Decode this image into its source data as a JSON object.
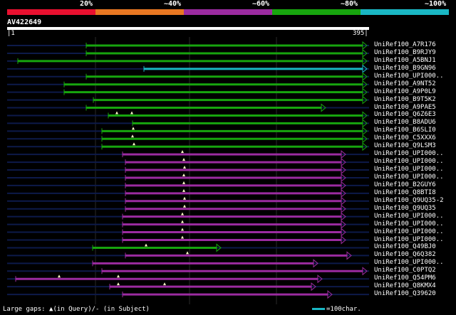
{
  "scale": {
    "ticks": [
      "20%",
      "~40%",
      "~60%",
      "~80%",
      "~100%"
    ],
    "colors": [
      "#e8102f",
      "#e87722",
      "#9b2ba0",
      "#17a50e",
      "#1ab7c4"
    ]
  },
  "query": {
    "name": "AV422649",
    "start": "|1",
    "end": "395|"
  },
  "hits": [
    {
      "name": "UniRef100_A7R176",
      "color": "green",
      "start": 121,
      "end": 515,
      "gaps": []
    },
    {
      "name": "UniRef100_B9RJY9",
      "color": "green",
      "start": 121,
      "end": 515,
      "gaps": []
    },
    {
      "name": "UniRef100_A5BNJ1",
      "color": "green",
      "start": 25,
      "end": 515,
      "gaps": []
    },
    {
      "name": "UniRef100_B9GN96",
      "color": "cyan",
      "start": 202,
      "end": 515,
      "gaps": []
    },
    {
      "name": "UniRef100_UPI000..",
      "color": "green",
      "start": 121,
      "end": 515,
      "gaps": []
    },
    {
      "name": "UniRef100_A9NT52",
      "color": "green",
      "start": 90,
      "end": 515,
      "gaps": []
    },
    {
      "name": "UniRef100_A9P0L9",
      "color": "green",
      "start": 90,
      "end": 515,
      "gaps": []
    },
    {
      "name": "UniRef100_B9T5K2",
      "color": "green",
      "start": 131,
      "end": 515,
      "gaps": []
    },
    {
      "name": "UniRef100_A9PAE5",
      "color": "green",
      "start": 121,
      "end": 457,
      "gaps": []
    },
    {
      "name": "UniRef100_Q6Z6E3",
      "color": "green",
      "start": 152,
      "end": 515,
      "gaps": [
        164,
        185
      ]
    },
    {
      "name": "UniRef100_B8ADU6",
      "color": "green",
      "start": 186,
      "end": 515,
      "gaps": []
    },
    {
      "name": "UniRef100_B6SLI0",
      "color": "green",
      "start": 143,
      "end": 515,
      "gaps": [
        187
      ]
    },
    {
      "name": "UniRef100_C5XXX6",
      "color": "green",
      "start": 143,
      "end": 515,
      "gaps": [
        186
      ]
    },
    {
      "name": "UniRef100_Q9LSM3",
      "color": "green",
      "start": 143,
      "end": 515,
      "gaps": [
        188
      ]
    },
    {
      "name": "UniRef100_UPI000..",
      "color": "purple",
      "start": 172,
      "end": 485,
      "gaps": [
        256
      ]
    },
    {
      "name": "UniRef100_UPI000..",
      "color": "purple",
      "start": 176,
      "end": 485,
      "gaps": [
        258
      ]
    },
    {
      "name": "UniRef100_UPI000..",
      "color": "purple",
      "start": 176,
      "end": 485,
      "gaps": [
        259
      ]
    },
    {
      "name": "UniRef100_UPI000..",
      "color": "purple",
      "start": 176,
      "end": 485,
      "gaps": [
        258
      ]
    },
    {
      "name": "UniRef100_B2GUY6",
      "color": "purple",
      "start": 176,
      "end": 485,
      "gaps": [
        258
      ]
    },
    {
      "name": "UniRef100_Q8BTI8",
      "color": "purple",
      "start": 176,
      "end": 485,
      "gaps": [
        258
      ]
    },
    {
      "name": "UniRef100_Q9UQ35-2",
      "color": "purple",
      "start": 176,
      "end": 485,
      "gaps": [
        259
      ]
    },
    {
      "name": "UniRef100_Q9UQ35",
      "color": "purple",
      "start": 176,
      "end": 485,
      "gaps": [
        259
      ]
    },
    {
      "name": "UniRef100_UPI000..",
      "color": "purple",
      "start": 172,
      "end": 485,
      "gaps": [
        256
      ]
    },
    {
      "name": "UniRef100_UPI000..",
      "color": "purple",
      "start": 172,
      "end": 485,
      "gaps": [
        256
      ]
    },
    {
      "name": "UniRef100_UPI000..",
      "color": "purple",
      "start": 172,
      "end": 485,
      "gaps": [
        256
      ]
    },
    {
      "name": "UniRef100_UPI000..",
      "color": "purple",
      "start": 172,
      "end": 485,
      "gaps": [
        256
      ]
    },
    {
      "name": "UniRef100_Q49BJ0",
      "color": "green",
      "start": 130,
      "end": 310,
      "gaps": [
        205
      ]
    },
    {
      "name": "UniRef100_Q6Q382",
      "color": "purple",
      "start": 176,
      "end": 493,
      "gaps": [
        263
      ]
    },
    {
      "name": "UniRef100_UPI000..",
      "color": "purple",
      "start": 130,
      "end": 446,
      "gaps": []
    },
    {
      "name": "UniRef100_C0PTQ2",
      "color": "purple",
      "start": 143,
      "end": 515,
      "gaps": []
    },
    {
      "name": "UniRef100_Q54PM6",
      "color": "purple",
      "start": 22,
      "end": 452,
      "gaps": [
        83,
        166
      ]
    },
    {
      "name": "UniRef100_Q8KMX4",
      "color": "purple",
      "start": 154,
      "end": 443,
      "gaps": [
        166,
        231
      ]
    },
    {
      "name": "UniRef100_Q39620",
      "color": "purple",
      "start": 172,
      "end": 466,
      "gaps": []
    }
  ],
  "hit_colors": {
    "green": "#17a50e",
    "purple": "#9b2ba0",
    "cyan": "#1ab7c4",
    "dark": "#0d1a4a"
  },
  "footer": {
    "gaps_text": "Large gaps: ▲(in Query)/- (in Subject)",
    "scale_text": "=100char."
  }
}
